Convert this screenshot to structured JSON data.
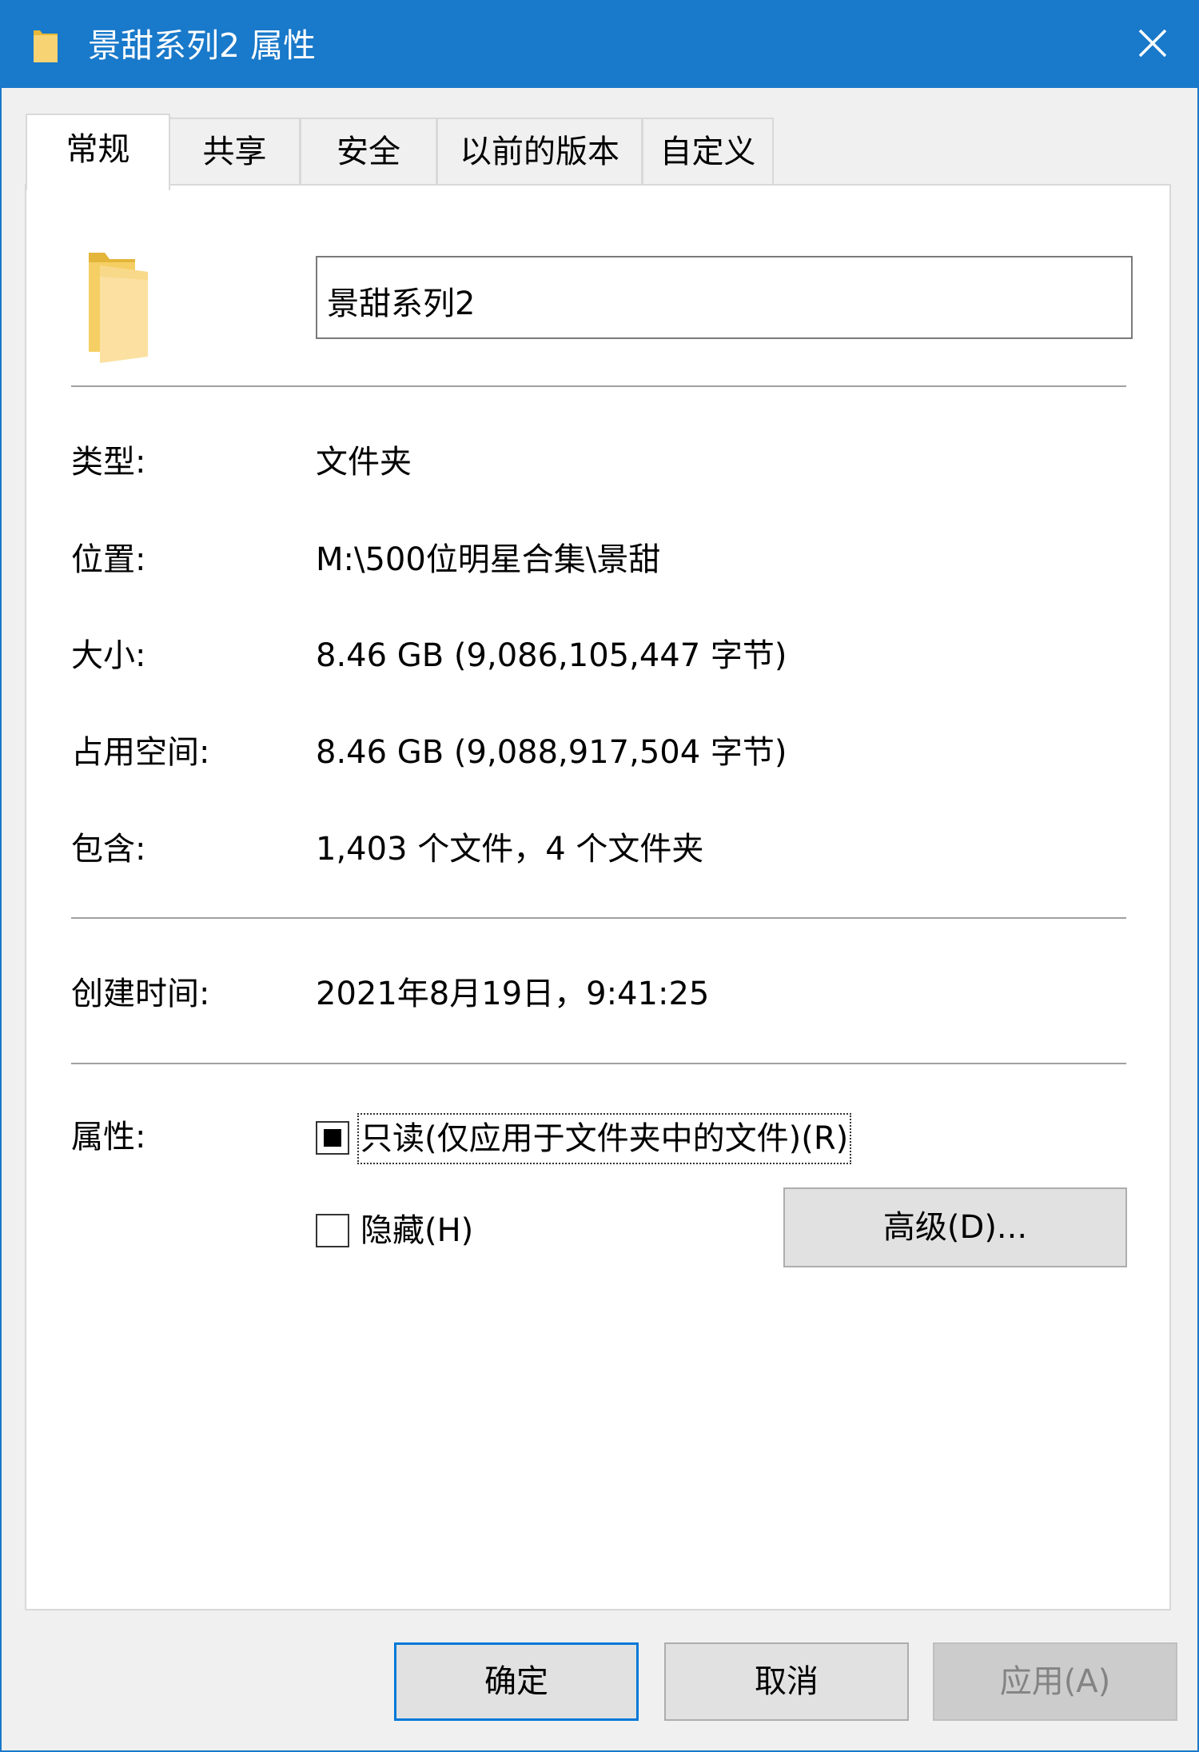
{
  "window": {
    "title": "景甜系列2 属性",
    "accent_color": "#1979ca",
    "title_icon": "folder-icon",
    "close_icon": "close-icon"
  },
  "tabs": [
    {
      "label": "常规",
      "active": true
    },
    {
      "label": "共享",
      "active": false
    },
    {
      "label": "安全",
      "active": false
    },
    {
      "label": "以前的版本",
      "active": false
    },
    {
      "label": "自定义",
      "active": false
    }
  ],
  "general": {
    "folder_icon": "folder-icon",
    "name_value": "景甜系列2",
    "type_label": "类型:",
    "type_value": "文件夹",
    "location_label": "位置:",
    "location_value": "M:\\500位明星合集\\景甜",
    "size_label": "大小:",
    "size_value": "8.46 GB (9,086,105,447 字节)",
    "disk_size_label": "占用空间:",
    "disk_size_value": "8.46 GB (9,088,917,504 字节)",
    "contains_label": "包含:",
    "contains_value": "1,403 个文件，4 个文件夹",
    "created_label": "创建时间:",
    "created_value": "2021年8月19日，9:41:25",
    "attributes_label": "属性:",
    "readonly_label": "只读(仅应用于文件夹中的文件)(R)",
    "readonly_state": "indeterminate",
    "hidden_label": "隐藏(H)",
    "hidden_state": "unchecked",
    "advanced_label": "高级(D)..."
  },
  "buttons": {
    "ok": "确定",
    "cancel": "取消",
    "apply": "应用(A)"
  }
}
